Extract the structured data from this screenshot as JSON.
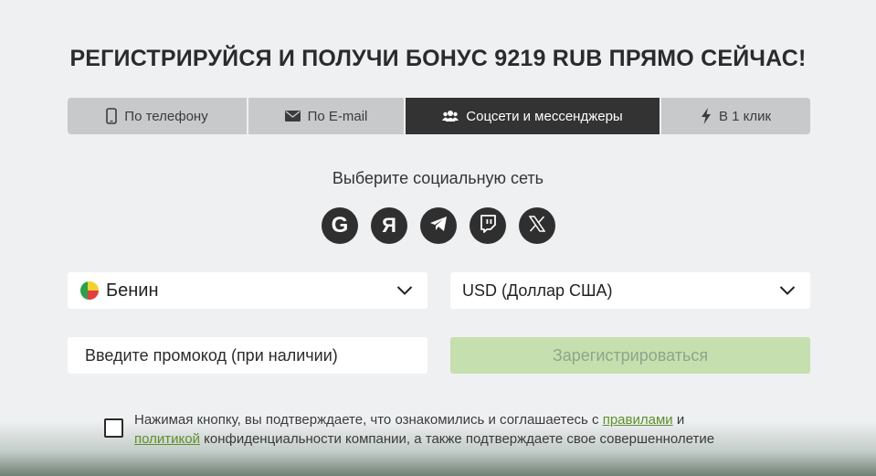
{
  "title": "РЕГИСТРИРУЙСЯ И ПОЛУЧИ БОНУС 9219 RUB ПРЯМО СЕЙЧАС!",
  "tabs": [
    {
      "label": "По телефону",
      "icon": "phone-icon",
      "active": false
    },
    {
      "label": "По E-mail",
      "icon": "envelope-icon",
      "active": false
    },
    {
      "label": "Соцсети и мессенджеры",
      "icon": "users-icon",
      "active": true
    },
    {
      "label": "В 1 клик",
      "icon": "lightning-icon",
      "active": false
    }
  ],
  "social": {
    "prompt": "Выберите социальную сеть",
    "networks": [
      {
        "name": "google",
        "glyph": "G"
      },
      {
        "name": "yandex",
        "glyph": "Я"
      },
      {
        "name": "telegram",
        "glyph": ""
      },
      {
        "name": "twitch",
        "glyph": ""
      },
      {
        "name": "x",
        "glyph": "𝕏"
      }
    ]
  },
  "form": {
    "country": "Бенин",
    "currency": "USD (Доллар США)",
    "promo_placeholder": "Введите промокод (при наличии)",
    "register_label": "Зарегистрироваться"
  },
  "terms": {
    "text_1": "Нажимая кнопку, вы подтверждаете, что ознакомились и соглашаетесь с ",
    "link_rules": "правилами",
    "text_2": " и",
    "link_policy": "политикой",
    "text_3": " конфиденциальности компании, а также подтверждаете свое совершеннолетие"
  },
  "colors": {
    "accent_green": "#c6dfae",
    "link_green": "#5f8f2a",
    "active_tab": "#333333",
    "inactive_tab": "#c8c9cb"
  }
}
